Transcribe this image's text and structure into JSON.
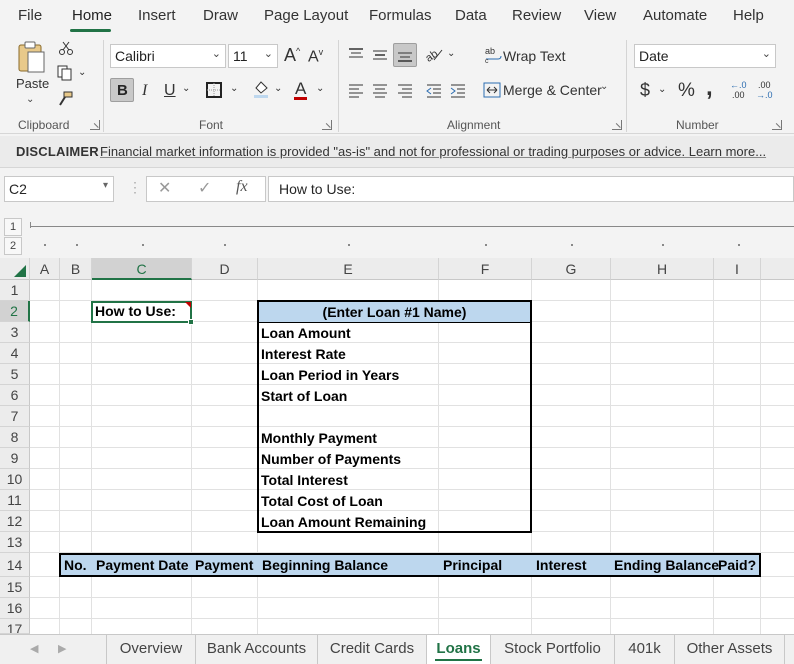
{
  "menu": {
    "items": [
      "File",
      "Home",
      "Insert",
      "Draw",
      "Page Layout",
      "Formulas",
      "Data",
      "Review",
      "View",
      "Automate",
      "Help"
    ],
    "active": "Home"
  },
  "ribbon": {
    "clipboard": {
      "paste_label": "Paste",
      "group_label": "Clipboard"
    },
    "font": {
      "font_name": "Calibri",
      "font_size": "11",
      "bold": "B",
      "italic": "I",
      "underline": "U",
      "font_color_glyph": "A",
      "grow_glyph": "A",
      "shrink_glyph": "A",
      "group_label": "Font"
    },
    "alignment": {
      "wrap_text": "Wrap Text",
      "merge_center": "Merge & Center",
      "group_label": "Alignment"
    },
    "number": {
      "format": "Date",
      "currency": "$",
      "percent": "%",
      "comma": ",",
      "increase_decimal_top": "←.0",
      "increase_decimal_bottom": ".00",
      "decrease_decimal_top": ".00",
      "decrease_decimal_bottom": "→.0",
      "group_label": "Number"
    }
  },
  "disclaimer": {
    "label": "DISCLAIMER",
    "text": "Financial market information is provided \"as-is\" and not for professional or trading purposes or advice. Learn more..."
  },
  "formula_bar": {
    "name_box": "C2",
    "cancel_glyph": "✕",
    "enter_glyph": "✓",
    "fx_glyph": "fx",
    "formula": "How to Use:"
  },
  "outline": {
    "levels": [
      "1",
      "2"
    ]
  },
  "grid": {
    "columns": [
      "A",
      "B",
      "C",
      "D",
      "E",
      "F",
      "G",
      "H",
      "I"
    ],
    "rows": [
      "1",
      "2",
      "3",
      "4",
      "5",
      "6",
      "7",
      "8",
      "9",
      "10",
      "11",
      "12",
      "13",
      "14",
      "15",
      "16",
      "17"
    ],
    "selected_cell": "C2",
    "how_to_use": "How to Use:",
    "loan_box": {
      "title": "(Enter Loan #1 Name)",
      "labels": [
        "Loan Amount",
        "Interest Rate",
        "Loan Period in Years",
        "Start of Loan",
        "",
        "Monthly Payment",
        "Number of Payments",
        "Total Interest",
        "Total Cost of Loan",
        "Loan Amount Remaining"
      ]
    },
    "schedule_headers": [
      "No.",
      "Payment Date",
      "Payment",
      "Beginning Balance",
      "Principal",
      "Interest",
      "Ending Balance",
      "Paid?"
    ]
  },
  "tabs": {
    "items": [
      "Overview",
      "Bank Accounts",
      "Credit Cards",
      "Loans",
      "Stock Portfolio",
      "401k",
      "Other Assets"
    ],
    "active": "Loans"
  },
  "colors": {
    "accent": "#217346",
    "header_fill": "#bdd7ee"
  }
}
